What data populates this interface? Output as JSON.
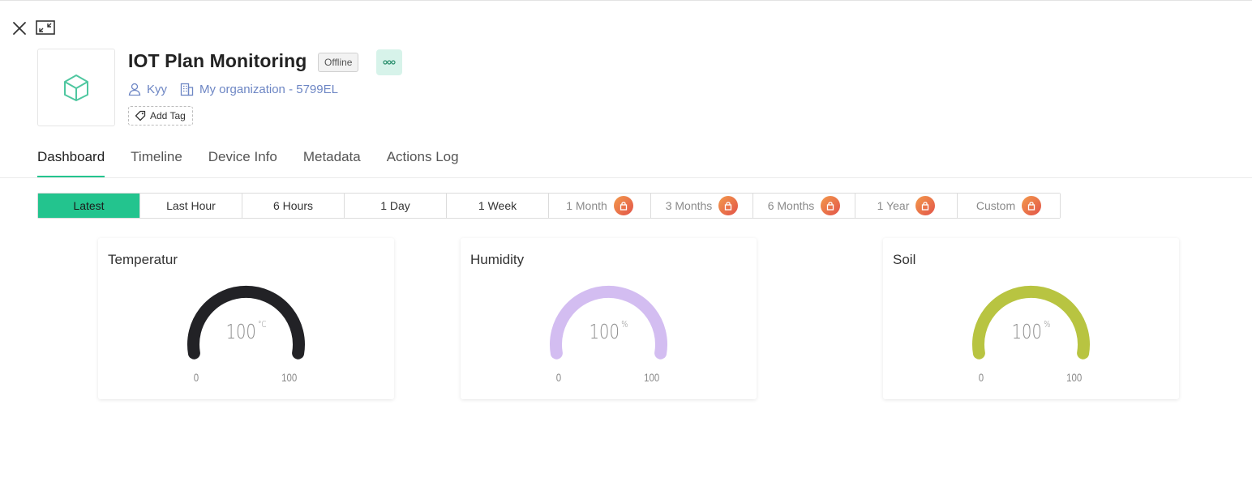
{
  "device": {
    "title": "IOT Plan Monitoring",
    "status": "Offline",
    "owner": "Kyy",
    "organization": "My organization - 5799EL",
    "add_tag_label": "Add Tag",
    "accent_color": "#23c48e"
  },
  "tabs": [
    {
      "label": "Dashboard",
      "active": true
    },
    {
      "label": "Timeline",
      "active": false
    },
    {
      "label": "Device Info",
      "active": false
    },
    {
      "label": "Metadata",
      "active": false
    },
    {
      "label": "Actions Log",
      "active": false
    }
  ],
  "time_ranges": [
    {
      "label": "Latest",
      "active": true,
      "locked": false
    },
    {
      "label": "Last Hour",
      "active": false,
      "locked": false
    },
    {
      "label": "6 Hours",
      "active": false,
      "locked": false
    },
    {
      "label": "1 Day",
      "active": false,
      "locked": false
    },
    {
      "label": "1 Week",
      "active": false,
      "locked": false
    },
    {
      "label": "1 Month",
      "active": false,
      "locked": true
    },
    {
      "label": "3 Months",
      "active": false,
      "locked": true
    },
    {
      "label": "6 Months",
      "active": false,
      "locked": true
    },
    {
      "label": "1 Year",
      "active": false,
      "locked": true
    },
    {
      "label": "Custom",
      "active": false,
      "locked": true
    }
  ],
  "widgets": [
    {
      "title": "Temperatur",
      "value": "100",
      "unit": "°C",
      "min": "0",
      "max": "100",
      "color": "#222226"
    },
    {
      "title": "Humidity",
      "value": "100",
      "unit": "%",
      "min": "0",
      "max": "100",
      "color": "#d3bdf1"
    },
    {
      "title": "Soil",
      "value": "100",
      "unit": "%",
      "min": "0",
      "max": "100",
      "color": "#b8c441"
    }
  ]
}
